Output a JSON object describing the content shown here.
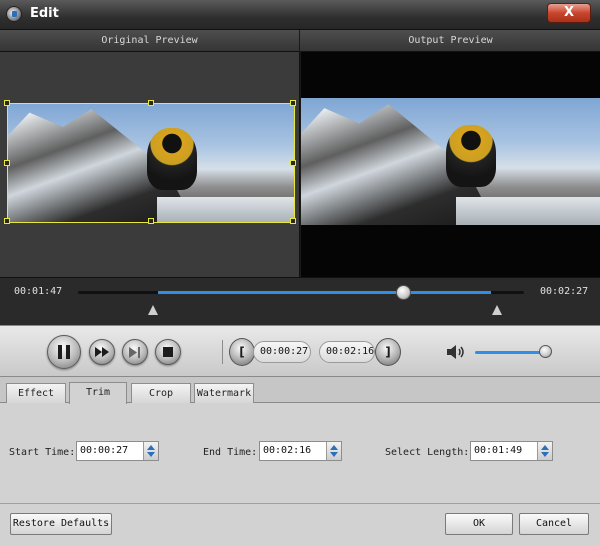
{
  "window": {
    "title": "Edit",
    "close_label": "X"
  },
  "preview": {
    "original_label": "Original Preview",
    "output_label": "Output Preview"
  },
  "timeline": {
    "current_time": "00:01:47",
    "total_time": "00:02:27",
    "playhead_fraction": 0.728,
    "range_start_fraction": 0.184,
    "range_end_fraction": 0.925
  },
  "controls": {
    "mark_in_time": "00:00:27",
    "mark_out_time": "00:02:16",
    "volume_fraction": 0.95
  },
  "tabs": [
    {
      "label": "Effect",
      "active": false
    },
    {
      "label": "Trim",
      "active": true
    },
    {
      "label": "Crop",
      "active": false
    },
    {
      "label": "Watermark",
      "active": false
    }
  ],
  "trim": {
    "start_label": "Start Time:",
    "start_value": "00:00:27",
    "end_label": "End Time:",
    "end_value": "00:02:16",
    "length_label": "Select Length:",
    "length_value": "00:01:49"
  },
  "footer": {
    "restore_label": "Restore Defaults",
    "ok_label": "OK",
    "cancel_label": "Cancel"
  },
  "colors": {
    "accent": "#2f8fe6",
    "crop_frame": "#e8e83a",
    "close_red": "#c9462c"
  }
}
